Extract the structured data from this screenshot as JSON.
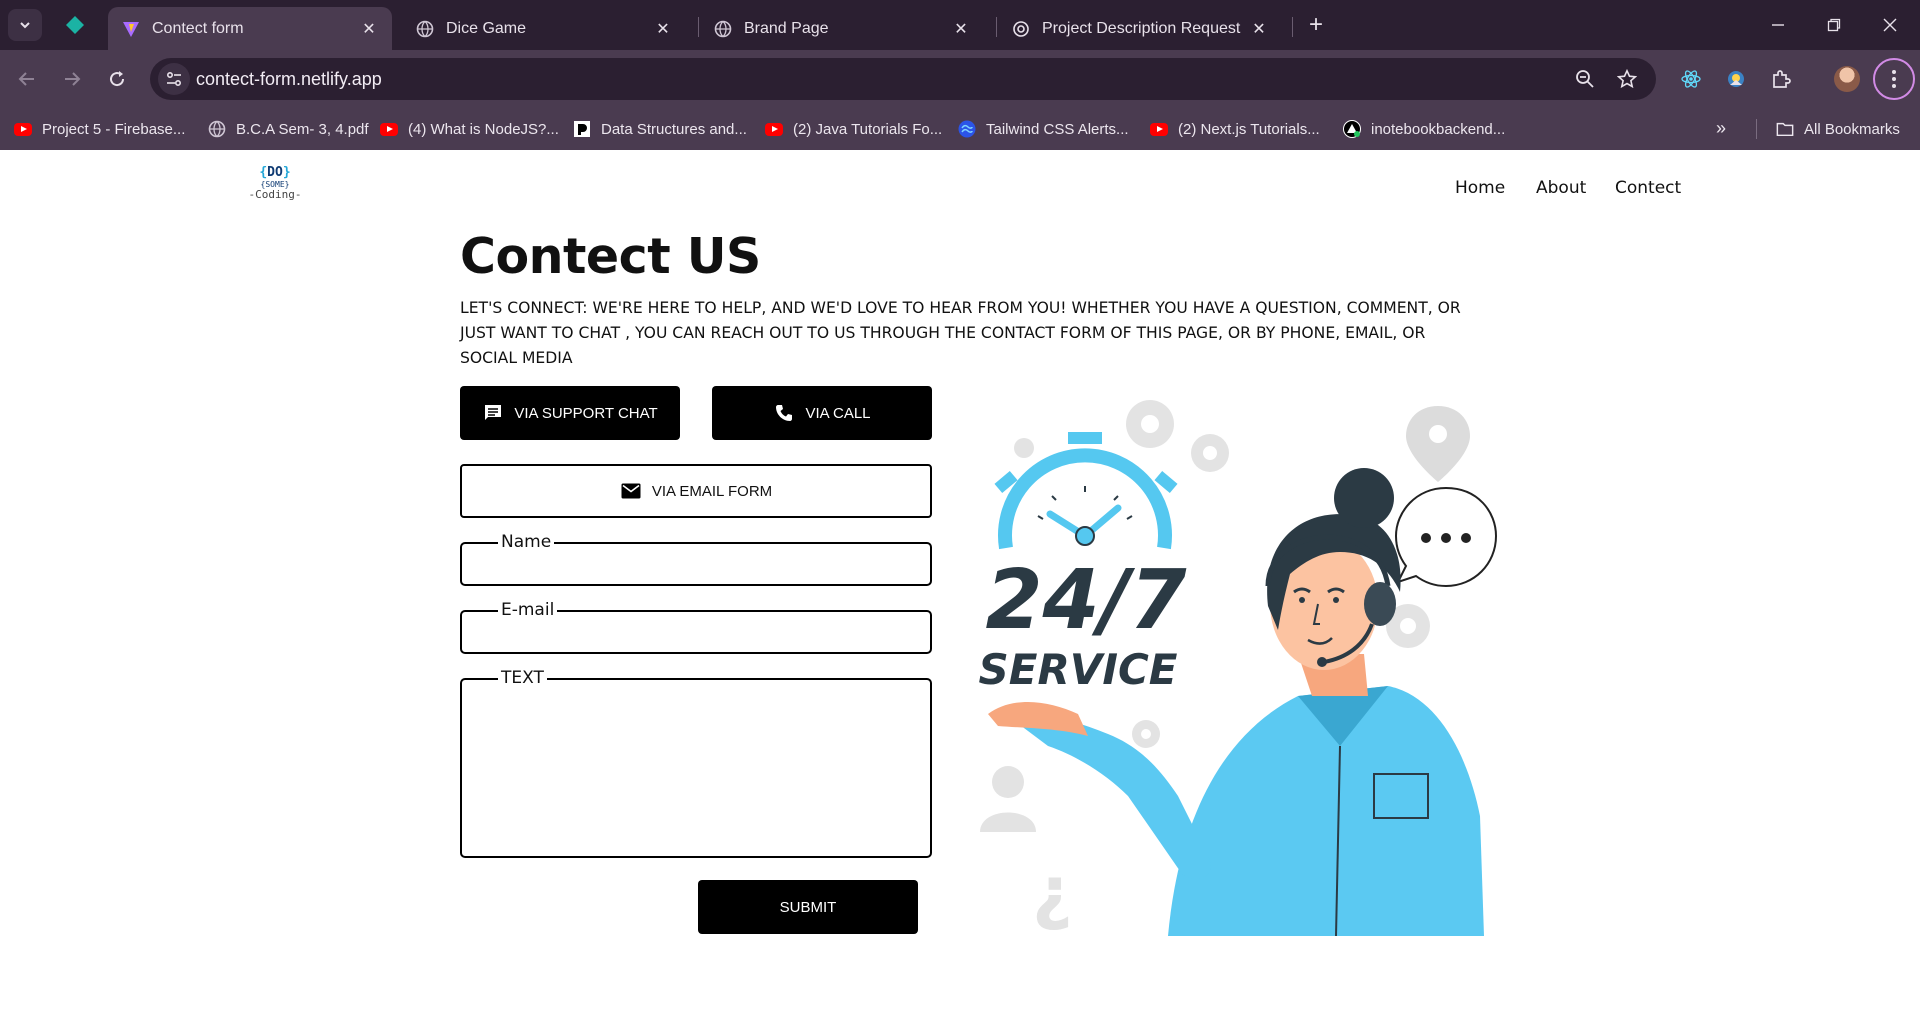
{
  "browser": {
    "tabs": [
      {
        "title": "Contect form",
        "active": true
      },
      {
        "title": "Dice Game",
        "active": false
      },
      {
        "title": "Brand Page",
        "active": false
      },
      {
        "title": "Project Description Request",
        "active": false
      }
    ],
    "url": "contect-form.netlify.app",
    "bookmarks": [
      {
        "label": "Project 5 - Firebase...",
        "icon": "youtube-icon"
      },
      {
        "label": "B.C.A Sem- 3, 4.pdf",
        "icon": "globe-icon"
      },
      {
        "label": "(4) What is NodeJS?...",
        "icon": "youtube-icon"
      },
      {
        "label": "Data Structures and...",
        "icon": "bookmark-site-icon"
      },
      {
        "label": "(2) Java Tutorials Fo...",
        "icon": "youtube-icon"
      },
      {
        "label": "Tailwind CSS Alerts...",
        "icon": "tailwind-icon"
      },
      {
        "label": "(2) Next.js Tutorials...",
        "icon": "youtube-icon"
      },
      {
        "label": "inotebookbackend...",
        "icon": "vercel-icon"
      }
    ],
    "all_bookmarks": "All Bookmarks"
  },
  "site": {
    "logo": {
      "line1_brace_open": "{",
      "line1_word": "DO",
      "line1_brace_close": "}",
      "line2": "{SOME}",
      "line3": "-Coding-"
    },
    "nav": [
      "Home",
      "About",
      "Contect"
    ]
  },
  "content": {
    "title": "Contect US",
    "subtitle": "LET'S CONNECT: WE'RE HERE TO HELP, AND WE'D LOVE TO HEAR FROM YOU! WHETHER YOU HAVE A QUESTION, COMMENT, OR JUST WANT TO CHAT , YOU CAN REACH OUT TO US THROUGH THE CONTACT FORM OF THIS PAGE, OR BY PHONE, EMAIL, OR SOCIAL MEDIA",
    "buttons": {
      "support_chat": "VIA SUPPORT CHAT",
      "call": "VIA CALL",
      "email_form": "VIA EMAIL FORM"
    },
    "form": {
      "name_label": "Name",
      "name_value": "",
      "email_label": "E-mail",
      "email_value": "",
      "text_label": "TEXT",
      "text_value": "",
      "submit": "SUBMIT"
    },
    "illustration": {
      "big_text": "24/7",
      "service_text": "SERVICE"
    }
  }
}
